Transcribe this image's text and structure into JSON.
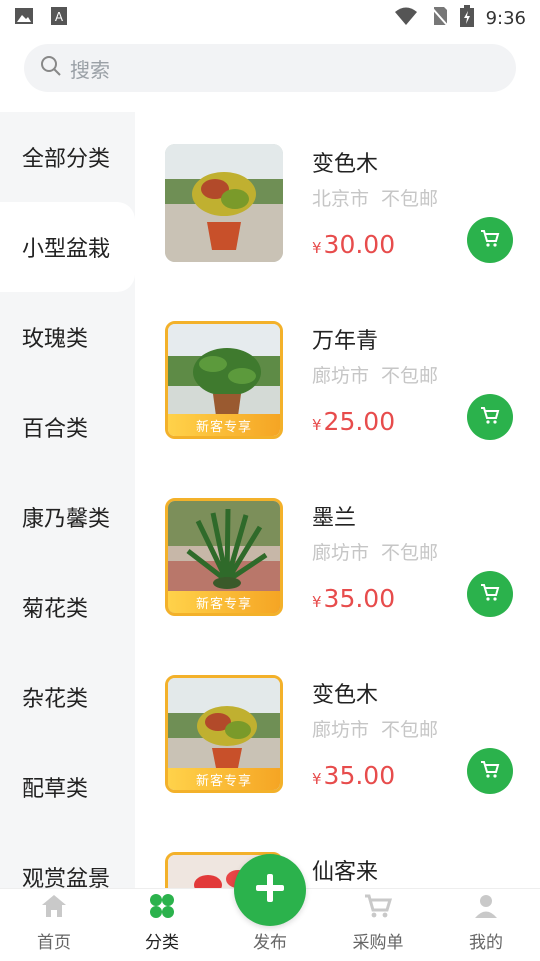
{
  "status_bar": {
    "time": "9:36"
  },
  "search": {
    "placeholder": "搜索"
  },
  "sidebar": {
    "items": [
      {
        "label": "全部分类"
      },
      {
        "label": "小型盆栽"
      },
      {
        "label": "玫瑰类"
      },
      {
        "label": "百合类"
      },
      {
        "label": "康乃馨类"
      },
      {
        "label": "菊花类"
      },
      {
        "label": "杂花类"
      },
      {
        "label": "配草类"
      },
      {
        "label": "观赏盆景"
      }
    ],
    "active_index": 1
  },
  "products": [
    {
      "name": "变色木",
      "city": "北京市",
      "shipping": "不包邮",
      "currency": "¥",
      "price": "30.00",
      "badge": ""
    },
    {
      "name": "万年青",
      "city": "廊坊市",
      "shipping": "不包邮",
      "currency": "¥",
      "price": "25.00",
      "badge": "新客专享"
    },
    {
      "name": "墨兰",
      "city": "廊坊市",
      "shipping": "不包邮",
      "currency": "¥",
      "price": "35.00",
      "badge": "新客专享"
    },
    {
      "name": "变色木",
      "city": "廊坊市",
      "shipping": "不包邮",
      "currency": "¥",
      "price": "35.00",
      "badge": "新客专享"
    },
    {
      "name": "仙客来",
      "city": "",
      "shipping": "",
      "currency": "",
      "price": "",
      "badge": ""
    }
  ],
  "tabbar": {
    "items": [
      {
        "label": "首页",
        "icon": "home-icon"
      },
      {
        "label": "分类",
        "icon": "category-icon"
      },
      {
        "label": "发布",
        "icon": "plus-icon"
      },
      {
        "label": "采购单",
        "icon": "cart-icon"
      },
      {
        "label": "我的",
        "icon": "user-icon"
      }
    ],
    "active_index": 1
  },
  "colors": {
    "accent": "#2bb24c",
    "price": "#e74c4c",
    "badge": "#f5a524"
  }
}
